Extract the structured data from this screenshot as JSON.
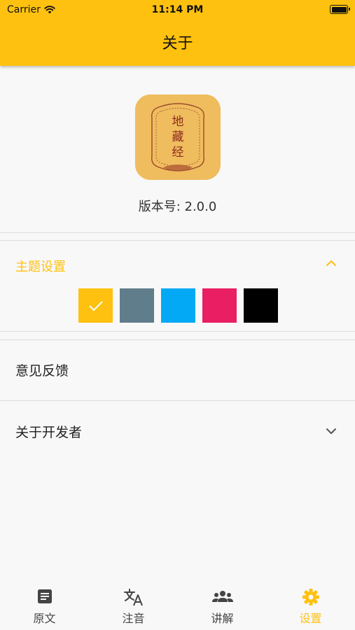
{
  "status_bar": {
    "carrier": "Carrier",
    "time": "11:14 PM"
  },
  "header": {
    "title": "关于"
  },
  "about": {
    "app_icon_text": "地藏经",
    "version_label": "版本号: 2.0.0"
  },
  "theme": {
    "label": "主题设置",
    "accent_color": "#fec10f",
    "swatches": [
      {
        "color": "#fec10f",
        "selected": true
      },
      {
        "color": "#607d8b",
        "selected": false
      },
      {
        "color": "#03a9f4",
        "selected": false
      },
      {
        "color": "#e91e63",
        "selected": false
      },
      {
        "color": "#000000",
        "selected": false
      }
    ]
  },
  "menu": {
    "feedback": "意见反馈",
    "about_developer": "关于开发者"
  },
  "tabbar": {
    "tabs": [
      {
        "label": "原文",
        "icon": "article-icon",
        "active": false
      },
      {
        "label": "注音",
        "icon": "translate-icon",
        "active": false
      },
      {
        "label": "讲解",
        "icon": "group-icon",
        "active": false
      },
      {
        "label": "设置",
        "icon": "gear-icon",
        "active": true
      }
    ]
  }
}
